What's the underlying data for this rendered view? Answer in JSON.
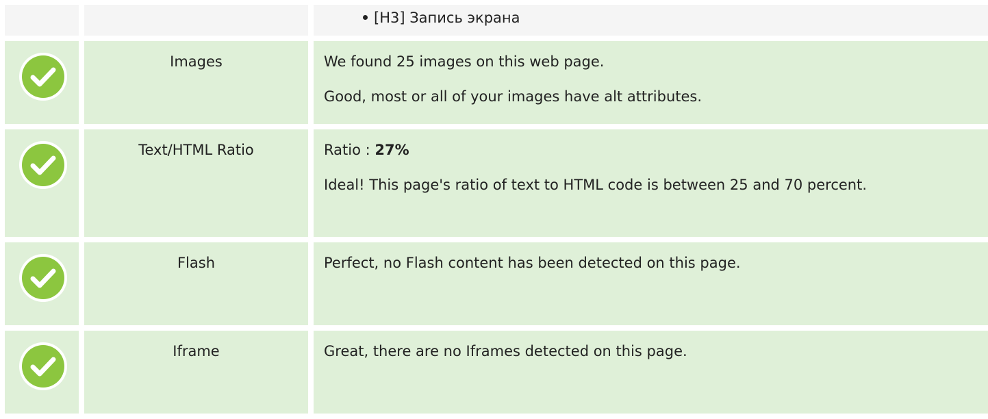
{
  "top_row": {
    "list_item": "[H3] Запись экрана"
  },
  "rows": [
    {
      "status_icon": "check-circle-icon",
      "label": "Images",
      "text1": "We found 25 images on this web page.",
      "text2": "Good, most or all of your images have alt attributes."
    },
    {
      "status_icon": "check-circle-icon",
      "label": "Text/HTML Ratio",
      "ratio_label": "Ratio : ",
      "ratio_value": "27%",
      "text2": "Ideal! This page's ratio of text to HTML code is between 25 and 70 percent."
    },
    {
      "status_icon": "check-circle-icon",
      "label": "Flash",
      "text1": "Perfect, no Flash content has been detected on this page."
    },
    {
      "status_icon": "check-circle-icon",
      "label": "Iframe",
      "text1": "Great, there are no Iframes detected on this page."
    }
  ],
  "colors": {
    "row_pass_bg": "#dff0d8",
    "row_neutral_bg": "#f5f5f5",
    "badge_green": "#8cc63f",
    "badge_border": "#ffffff"
  }
}
